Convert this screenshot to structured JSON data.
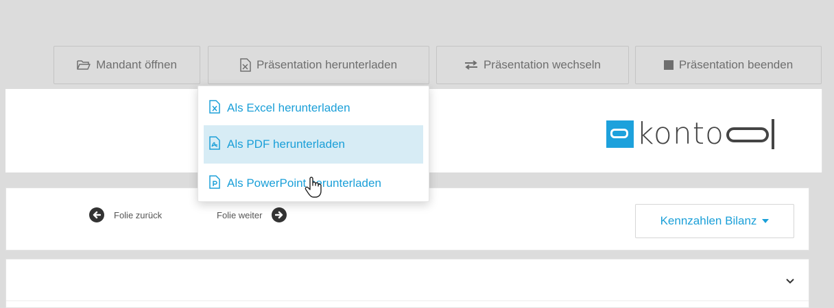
{
  "toolbar": {
    "open_client": "Mandant öffnen",
    "download_presentation": "Präsentation herunterladen",
    "switch_presentation": "Präsentation wechseln",
    "end_presentation": "Präsentation beenden"
  },
  "download_menu": {
    "items": [
      {
        "label": "Als Excel herunterladen",
        "icon": "excel-file-icon"
      },
      {
        "label": "Als PDF herunterladen",
        "icon": "pdf-file-icon",
        "highlighted": true
      },
      {
        "label": "Als PowerPoint herunterladen",
        "icon": "powerpoint-file-icon"
      }
    ]
  },
  "brand": {
    "logo_text": "konto",
    "accent_color": "#1da1dc"
  },
  "slide_nav": {
    "prev_label": "Folie zurück",
    "next_label": "Folie weiter"
  },
  "metrics_dropdown": {
    "selected": "Kennzahlen Bilanz"
  },
  "colors": {
    "link_blue": "#1a9fd8",
    "menu_highlight": "#d7ecf5",
    "toolbar_bg": "#dcdcdc"
  }
}
